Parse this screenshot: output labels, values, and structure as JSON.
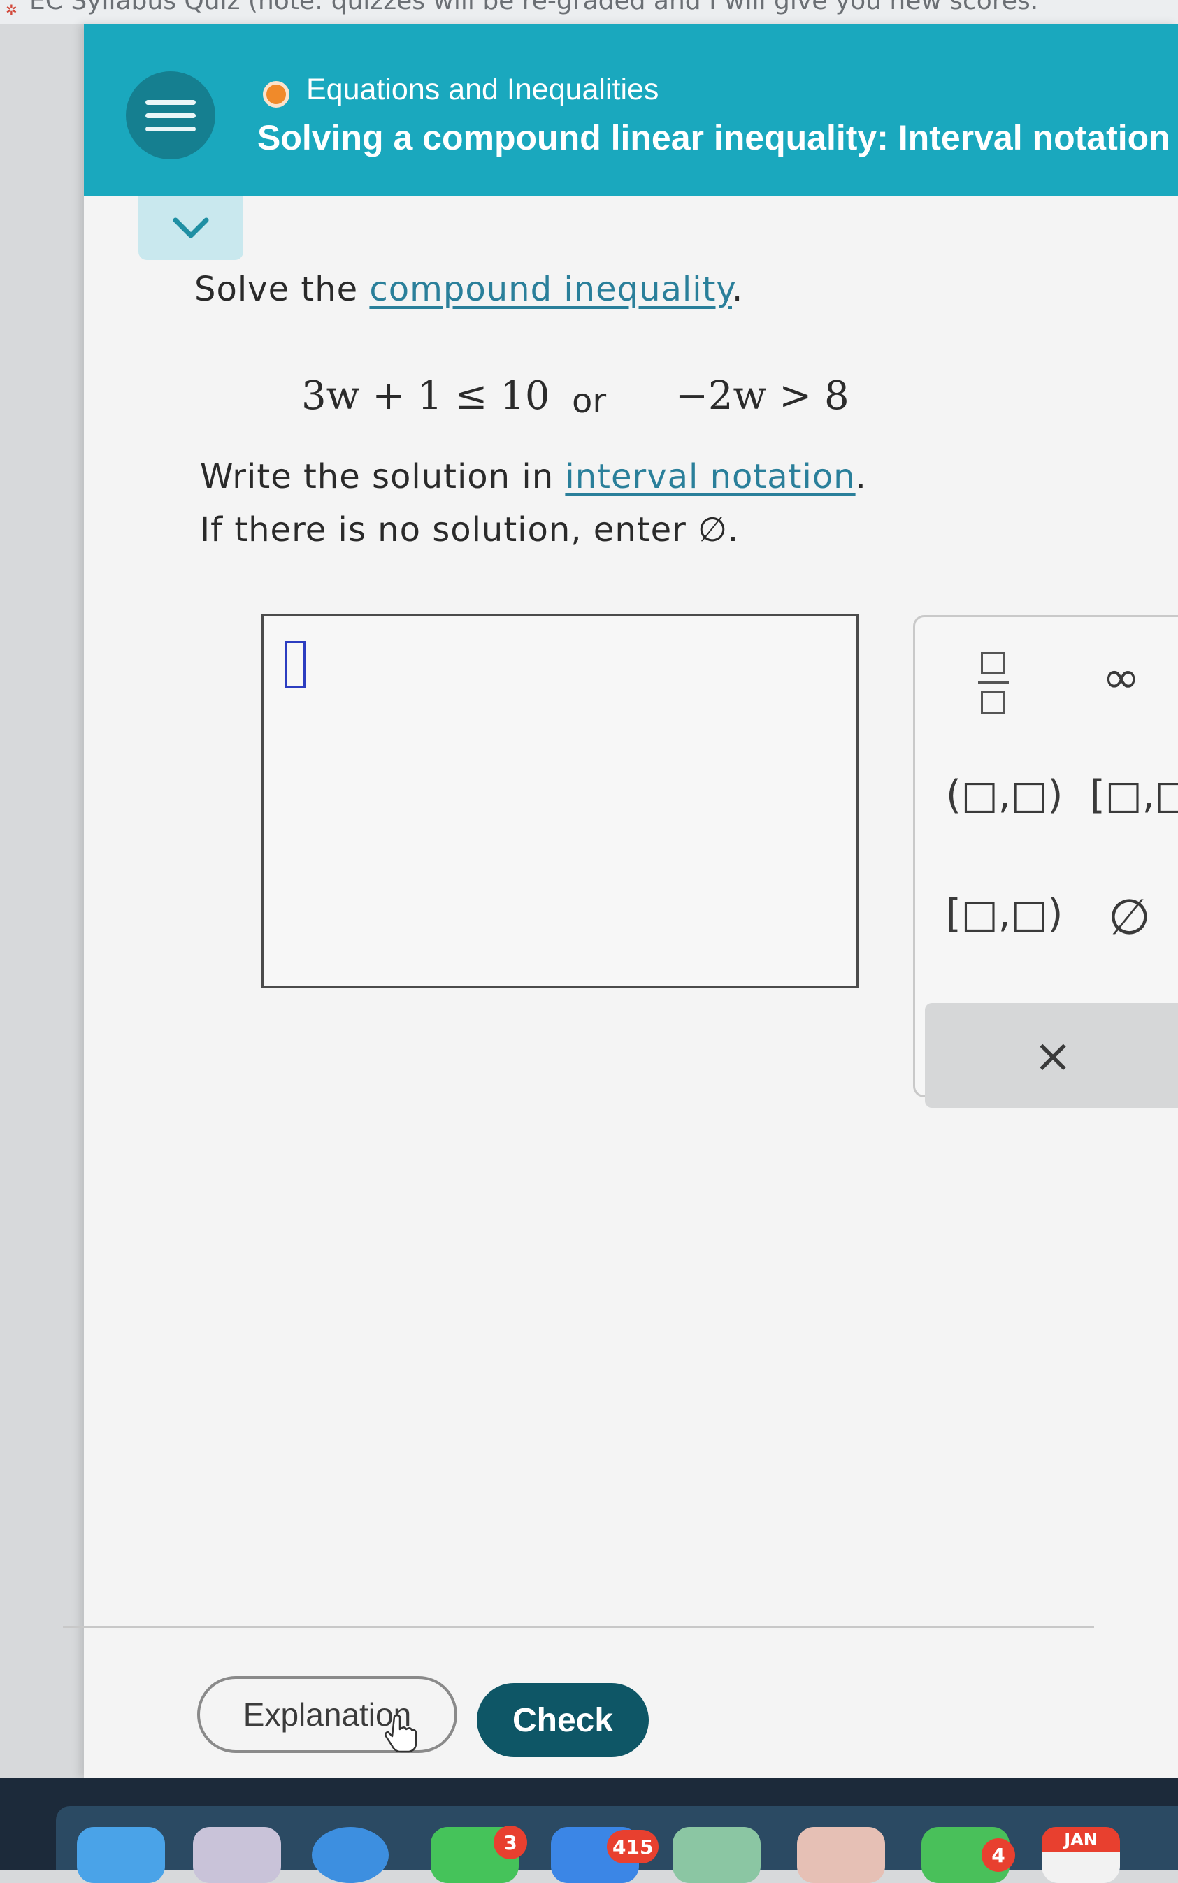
{
  "browser": {
    "tab_title": "EC Syllabus Quiz (note: quizzes will be re-graded and I will give you new scores."
  },
  "header": {
    "topic": "Equations and Inequalities",
    "subtitle": "Solving a compound linear inequality: Interval notation",
    "status_color": "#f08a2a"
  },
  "problem": {
    "prompt_prefix": "Solve the ",
    "prompt_link": "compound inequality",
    "prompt_suffix": ".",
    "inequality_1": "3w + 1 ≤ 10",
    "connector": "or",
    "inequality_2": "−2w > 8",
    "instruction_prefix": "Write the solution in ",
    "instruction_link": "interval notation",
    "instruction_suffix": ".",
    "no_solution_text": "If there is no solution, enter ∅."
  },
  "answer": {
    "value": ""
  },
  "keypad": {
    "infinity": "∞",
    "open_open": "(□,□)",
    "closed_closed": "[□,□",
    "closed_open": "[□,□)",
    "empty_set": "∅",
    "backspace": "×"
  },
  "buttons": {
    "explanation": "Explanation",
    "check": "Check"
  },
  "dock": {
    "badge_mail": "3",
    "badge_messages": "415",
    "badge_other": "4",
    "calendar_month": "JAN"
  },
  "colors": {
    "header": "#1aa8be",
    "check_button": "#0e5666",
    "link": "#2a7f9a"
  }
}
